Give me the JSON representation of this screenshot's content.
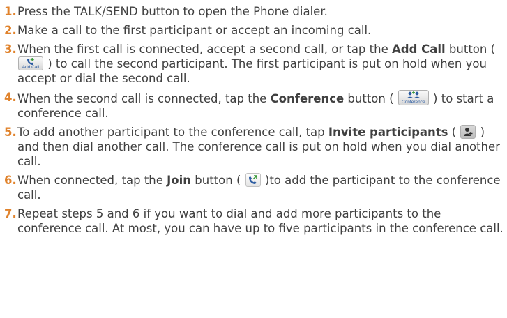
{
  "steps": [
    {
      "number": "1.",
      "text": "Press the TALK/SEND button to open the Phone dialer."
    },
    {
      "number": "2.",
      "text": "Make a call to the first participant or accept an incoming call."
    },
    {
      "number": "3.",
      "before": "When the first call is connected, accept a second call, or tap the ",
      "bold": "Add Call",
      "middle": " button ( ",
      "icon": "add-call-icon",
      "icon_caption": "Add Call",
      "after": " ) to call the second participant. The first participant is put on hold when you accept or dial the second call."
    },
    {
      "number": "4.",
      "before": "When the second call is connected, tap the ",
      "bold": "Conference",
      "middle": " button ( ",
      "icon": "conference-icon",
      "icon_caption": "Conference",
      "after": " ) to start a conference call."
    },
    {
      "number": "5.",
      "before": "To add another participant to the conference call, tap ",
      "bold": "Invite participants",
      "middle": " ( ",
      "icon": "invite-participants-icon",
      "after": " ) and then dial another call. The conference call is put on hold when you dial another call."
    },
    {
      "number": "6.",
      "before": "When connected, tap the ",
      "bold": "Join",
      "middle": " button ( ",
      "icon": "join-icon",
      "after": " )to add the participant to the conference call."
    },
    {
      "number": "7.",
      "text": "Repeat steps 5 and 6 if you want to dial and add more participants to the conference call. At most, you can have up to five participants in the conference call."
    }
  ],
  "colors": {
    "number": "#e0822b",
    "text": "#404040",
    "icon_blue": "#2a5aa0",
    "icon_green": "#3a9a3a"
  }
}
